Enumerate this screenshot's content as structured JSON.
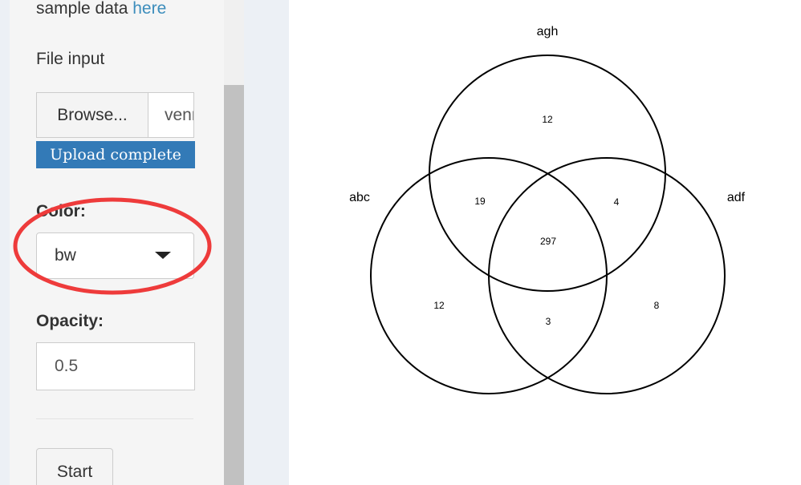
{
  "sidebar": {
    "sample_text": "sample data ",
    "sample_link": "here",
    "file_input_label": "File input",
    "browse_label": "Browse...",
    "file_name_value": "venn",
    "upload_status": "Upload complete",
    "color_label": "Color:",
    "color_value": "bw",
    "opacity_label": "Opacity:",
    "opacity_value": "0.5",
    "start_label": "Start"
  },
  "venn": {
    "set_labels": {
      "top": "agh",
      "left": "abc",
      "right": "adf"
    },
    "counts": {
      "only_agh": "12",
      "abc_agh": "19",
      "agh_adf": "4",
      "all_three": "297",
      "only_abc": "12",
      "abc_adf": "3",
      "only_adf": "8"
    }
  },
  "colors": {
    "accent_blue": "#337ab7",
    "link_blue": "#3c8dbc",
    "highlight_red": "#ee3b3b"
  }
}
